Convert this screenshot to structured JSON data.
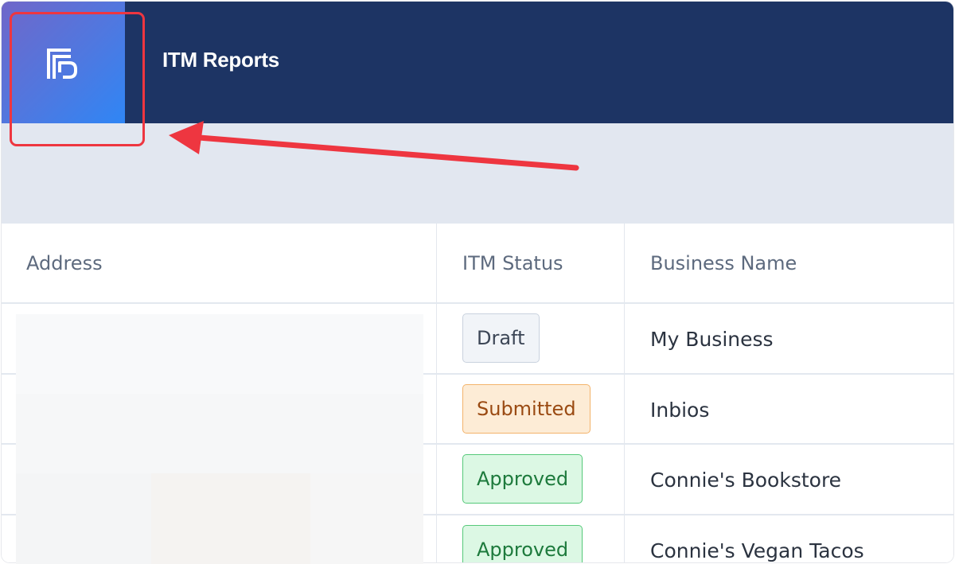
{
  "header": {
    "logo_icon": "document-report-icon",
    "title": "ITM Reports",
    "background": "#1d3464",
    "logo_gradient": [
      "#7067c9",
      "#2f86f5"
    ]
  },
  "table": {
    "columns": [
      "Address",
      "ITM Status",
      "Business Name"
    ],
    "rows": [
      {
        "status": "Draft",
        "business": "My Business"
      },
      {
        "status": "Submitted",
        "business": "Inbios"
      },
      {
        "status": "Approved",
        "business": "Connie's Bookstore"
      },
      {
        "status": "Approved",
        "business": "Connie's Vegan Tacos"
      }
    ]
  },
  "status_colors": {
    "Draft": {
      "bg": "#f1f4f8",
      "border": "#c9d2de",
      "text": "#3c4656"
    },
    "Submitted": {
      "bg": "#fdecd6",
      "border": "#f3b36b",
      "text": "#9a4a12"
    },
    "Approved": {
      "bg": "#dcf8e4",
      "border": "#56c97a",
      "text": "#1d7a3c"
    }
  },
  "annotation": {
    "color": "#ee3640"
  }
}
